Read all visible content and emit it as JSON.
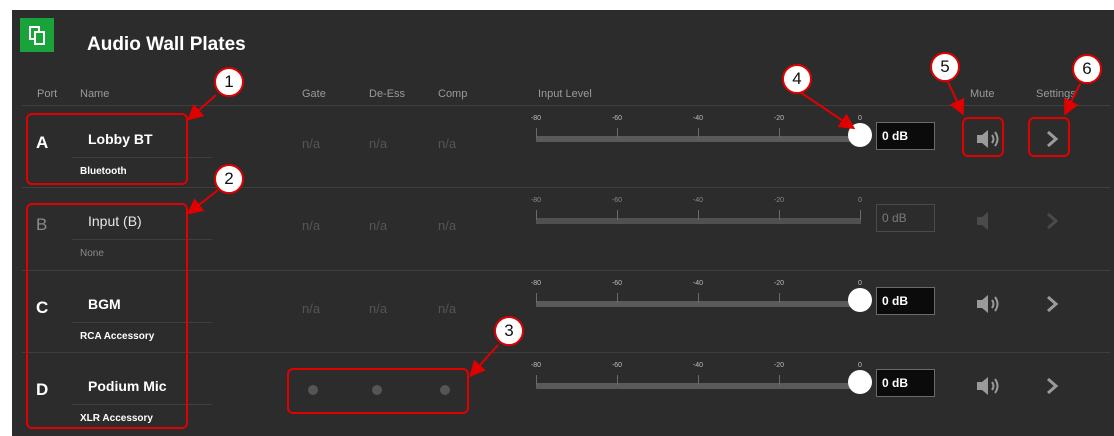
{
  "app": {
    "title": "Audio Wall Plates",
    "icon": "copy-icon"
  },
  "headers": {
    "port": "Port",
    "name": "Name",
    "gate": "Gate",
    "deess": "De-Ess",
    "comp": "Comp",
    "input_level": "Input Level",
    "mute": "Mute",
    "settings": "Settings"
  },
  "scale": [
    "-80",
    "-60",
    "-40",
    "-20",
    "0"
  ],
  "rows": [
    {
      "port": "A",
      "name": "Lobby BT",
      "sub": "Bluetooth",
      "gate": "n/a",
      "deess": "n/a",
      "comp": "n/a",
      "level": "0 dB",
      "enabled": true
    },
    {
      "port": "B",
      "name": "Input (B)",
      "sub": "None",
      "gate": "n/a",
      "deess": "n/a",
      "comp": "n/a",
      "level": "0 dB",
      "enabled": false
    },
    {
      "port": "C",
      "name": "BGM",
      "sub": "RCA Accessory",
      "gate": "n/a",
      "deess": "n/a",
      "comp": "n/a",
      "level": "0 dB",
      "enabled": true
    },
    {
      "port": "D",
      "name": "Podium Mic",
      "sub": "XLR Accessory",
      "level": "0 dB",
      "enabled": true
    }
  ],
  "annotations": [
    "1",
    "2",
    "3",
    "4",
    "5",
    "6"
  ],
  "colors": {
    "accent_green": "#1aa33a",
    "annotation_red": "#e00000",
    "panel_bg": "#2c2c2c"
  }
}
